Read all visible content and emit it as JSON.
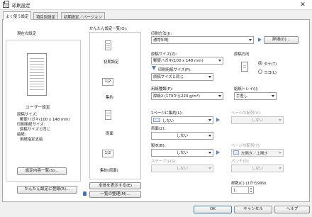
{
  "window": {
    "title": "印刷設定",
    "close": "✕"
  },
  "tabs": [
    "よく使う設定",
    "項目別設定",
    "初期設定／バージョン"
  ],
  "current": {
    "group_label": "現在の設定",
    "heading": "ユーザー設定",
    "details": [
      "原稿サイズ:",
      "郵便ハガキ(100 x 148 mm)",
      "印刷用紙サイズ:",
      "原稿サイズと同じ",
      "給紙:",
      "用紙指定支給"
    ],
    "list_button": "設定内容一覧(S)..."
  },
  "presets": {
    "label": "かんたん設定一覧(O):",
    "items": [
      "初期設定",
      "集約",
      "両面",
      "集約(両面)"
    ],
    "show_all": "全体を表示する(E)",
    "organize": "一覧の整理(M)..."
  },
  "register_button": "かんたん設定に登録(R)...",
  "form": {
    "print_method_label": "印刷方法(J):",
    "print_method": "通常印刷",
    "details_button": "詳細(D)...",
    "orig_size_label": "原稿サイズ(Z):",
    "orig_size": "郵便ハガキ(100 x 148 mm)",
    "paper_size_label": "印刷用紙サイズ(P):",
    "paper_size": "原稿サイズと同じ",
    "orientation_label": "原稿方向",
    "orient_portrait": "タテ(T)",
    "orient_landscape": "ヨコ(L)",
    "paper_type_label": "用紙種類(P):",
    "paper_type": "厚紙2 (170から220 g/m²)",
    "tray_label": "給紙トレイ(I):",
    "tray": "手差し",
    "pages_label": "1ページに集約(L):",
    "pages": "しない",
    "page_order_label": "ページの配列(V):",
    "page_order": "しない",
    "duplex_label": "両面(2):",
    "duplex": "しない",
    "binding_label": "製本(B):",
    "binding": "しない",
    "binding_order_label": "ページの配列(Y):",
    "binding_order": "左開き／上開き",
    "staple_label": "ステープル(S):",
    "staple": "しない",
    "punch_label": "パンチ(P):",
    "punch": "しない",
    "copies_label": "部数(C):(1から999)",
    "copies": "1"
  },
  "footer": {
    "ok": "OK",
    "cancel": "キャンセル",
    "help": "ヘルプ"
  }
}
